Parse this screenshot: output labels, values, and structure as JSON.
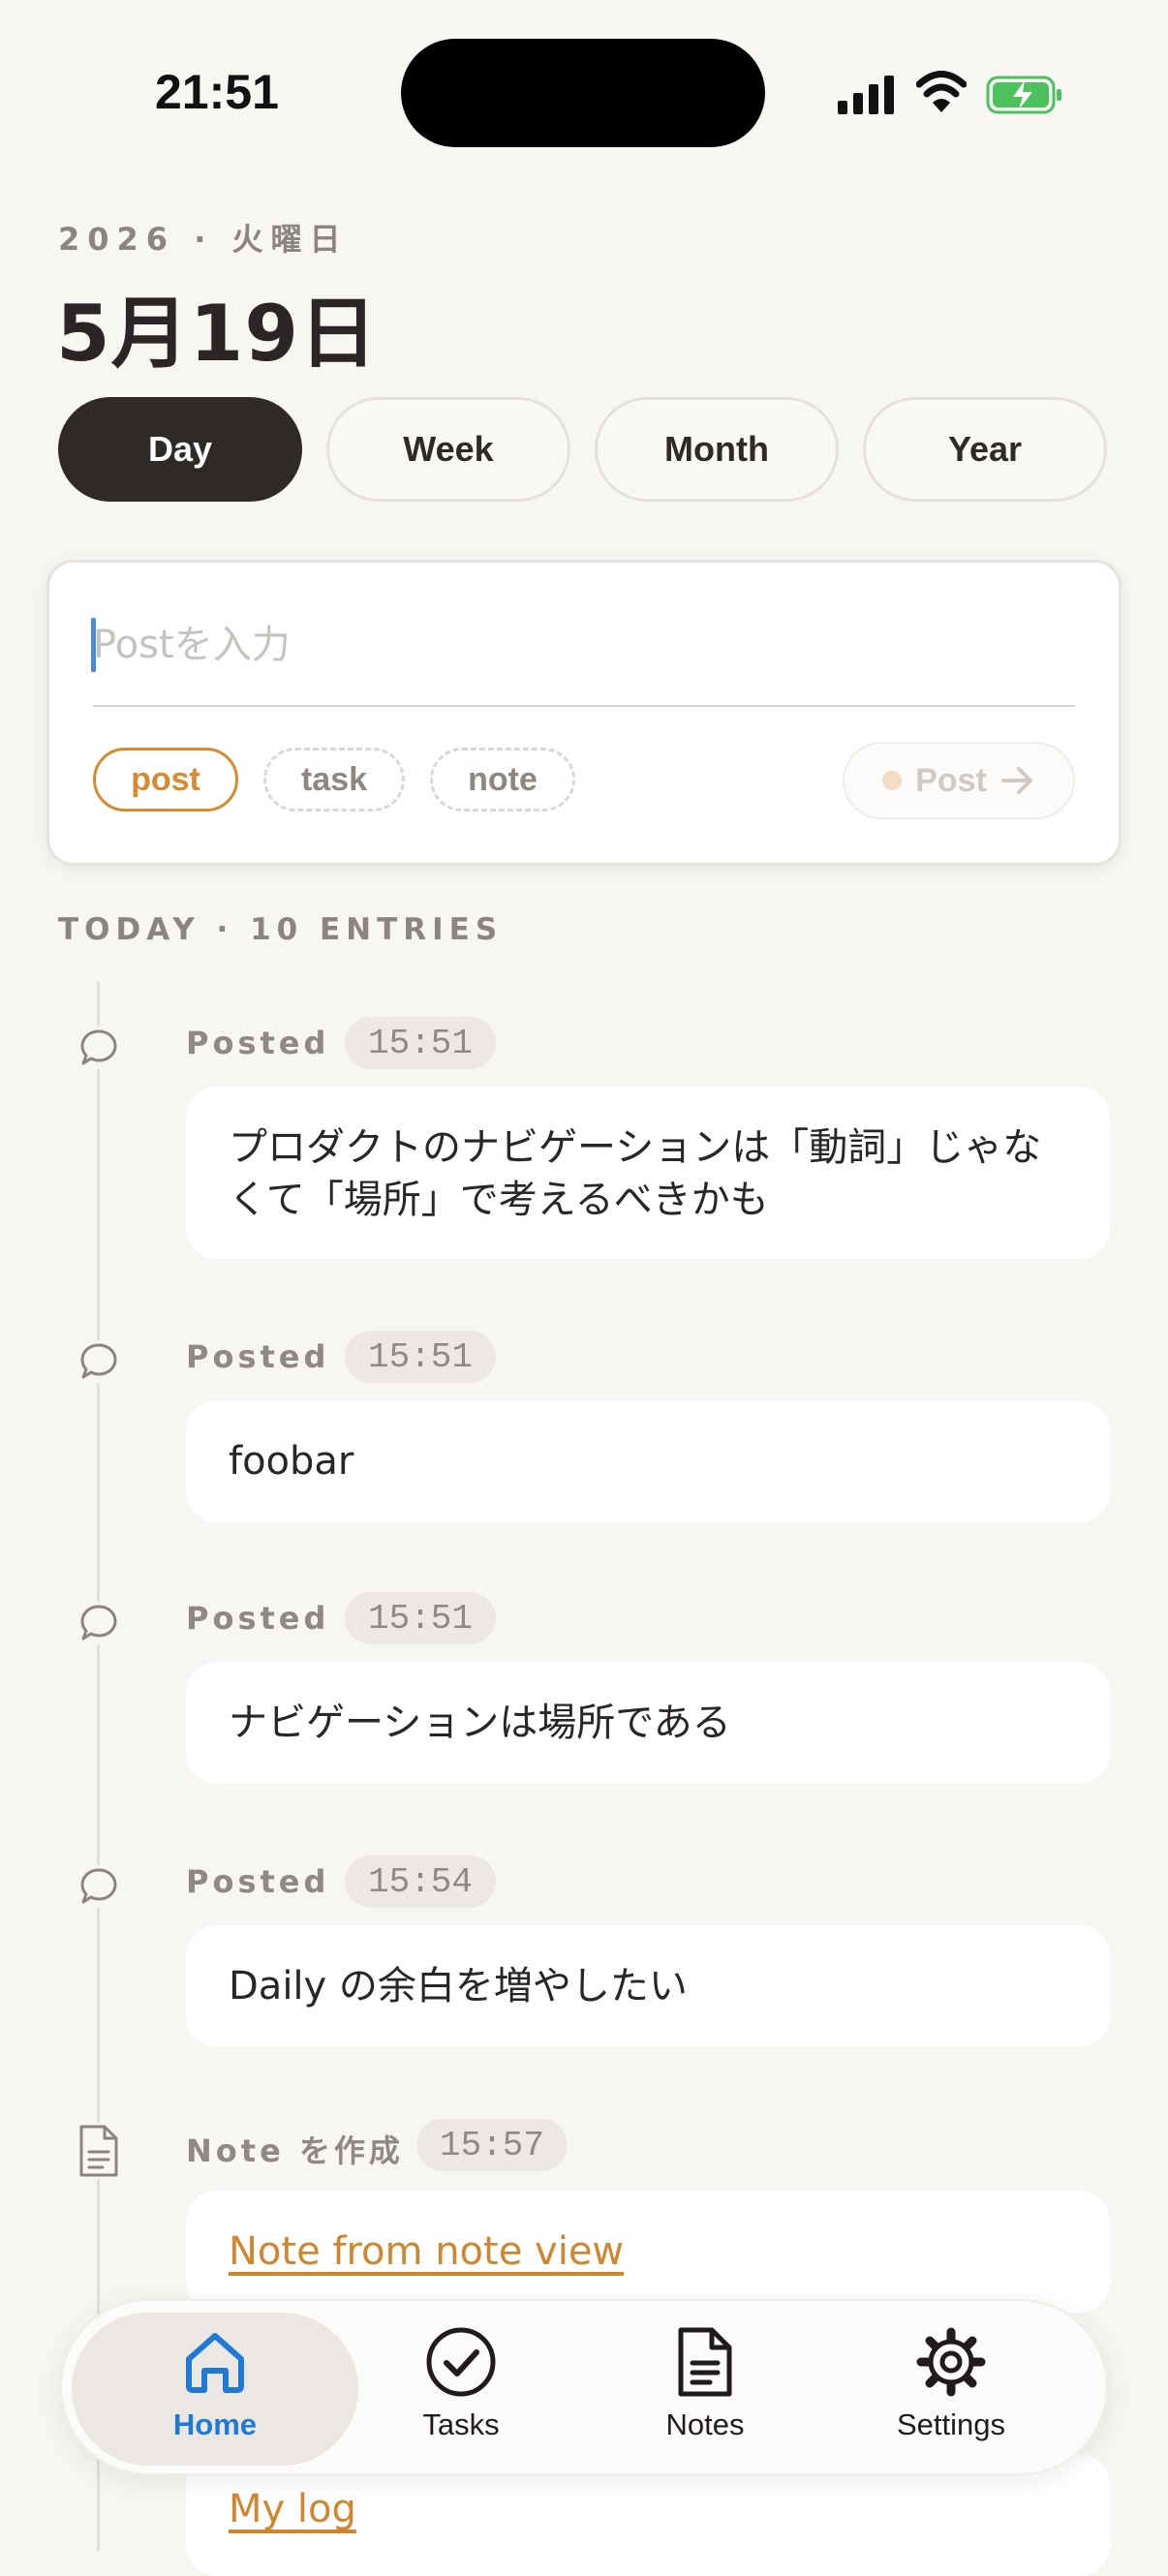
{
  "status_bar": {
    "time": "21:51"
  },
  "header": {
    "date_sub": "2026 · 火曜日",
    "date_title": "5月19日"
  },
  "segments": [
    "Day",
    "Week",
    "Month",
    "Year"
  ],
  "composer": {
    "placeholder": "Postを入力",
    "value": "",
    "types": [
      "post",
      "task",
      "note"
    ],
    "selected_type": "post",
    "submit_label": "Post"
  },
  "timeline": {
    "title": "TODAY · 10 ENTRIES",
    "entries": [
      {
        "icon": "chat-bubble-icon",
        "label": "Posted",
        "time": "15:51",
        "text": "プロダクトのナビゲーションは「動詞」じゃなくて「場所」で考えるべきかも"
      },
      {
        "icon": "chat-bubble-icon",
        "label": "Posted",
        "time": "15:51",
        "text": "foobar"
      },
      {
        "icon": "chat-bubble-icon",
        "label": "Posted",
        "time": "15:51",
        "text": "ナビゲーションは場所である"
      },
      {
        "icon": "chat-bubble-icon",
        "label": "Posted",
        "time": "15:54",
        "text": "Daily の余白を増やしたい"
      },
      {
        "icon": "document-icon",
        "label": "Note を作成",
        "time": "15:57",
        "text": "Note from note view"
      },
      {
        "icon": "document-icon",
        "label": "",
        "time": "",
        "text": "My log"
      }
    ]
  },
  "tabbar": {
    "accent": "#1e7ad6",
    "items": [
      {
        "label": "Home",
        "icon": "house-icon",
        "active": true
      },
      {
        "label": "Tasks",
        "icon": "check-circle-icon",
        "active": false
      },
      {
        "label": "Notes",
        "icon": "document-icon",
        "active": false
      },
      {
        "label": "Settings",
        "icon": "gear-icon",
        "active": false
      }
    ]
  }
}
